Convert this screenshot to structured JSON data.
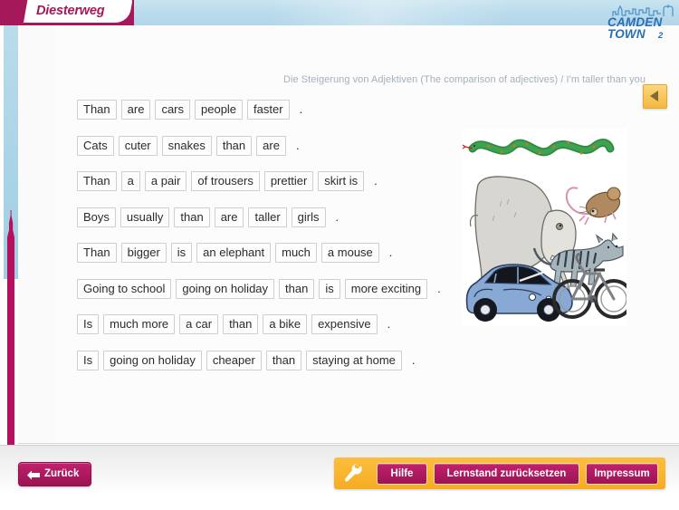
{
  "header": {
    "publisher_logo": "Diesterweg",
    "series_logo_line1": "CAMDEN",
    "series_logo_line2": "TOWN",
    "series_logo_number": "2",
    "skyline_icon": "london-skyline-icon"
  },
  "lesson": {
    "subtitle": "Die Steigerung von Adjektiven (The comparison of adjectives) / I'm taller than you"
  },
  "exercise": {
    "rows": [
      {
        "words": [
          "Than",
          "are",
          "cars",
          "people",
          "faster"
        ],
        "punctuation": "."
      },
      {
        "words": [
          "Cats",
          "cuter",
          "snakes",
          "than",
          "are"
        ],
        "punctuation": "."
      },
      {
        "words": [
          "Than",
          "a",
          "a pair",
          "of trousers",
          "prettier",
          "skirt is"
        ],
        "punctuation": "."
      },
      {
        "words": [
          "Boys",
          "usually",
          "than",
          "are",
          "taller",
          "girls"
        ],
        "punctuation": "."
      },
      {
        "words": [
          "Than",
          "bigger",
          "is",
          "an elephant",
          "much",
          "a mouse"
        ],
        "punctuation": "."
      },
      {
        "words": [
          "Going to school",
          "going on holiday",
          "than",
          "is",
          "more exciting"
        ],
        "punctuation": "."
      },
      {
        "words": [
          "Is",
          "much more",
          "a car",
          "than",
          "a bike",
          "expensive"
        ],
        "punctuation": "."
      },
      {
        "words": [
          "Is",
          "going on holiday",
          "cheaper",
          "than",
          "staying at home"
        ],
        "punctuation": "."
      }
    ]
  },
  "illustration": {
    "name": "animals-and-vehicles-illustration",
    "subjects": [
      "snake",
      "elephant",
      "mouse",
      "cat",
      "car",
      "bicycle"
    ]
  },
  "side_tab": {
    "icon": "triangle-left-icon"
  },
  "footer": {
    "back_label": "Zurück",
    "back_icon": "arrow-left-icon",
    "tools_icon": "wrench-icon",
    "help_label": "Hilfe",
    "reset_label": "Lernstand zurücksetzen",
    "imprint_label": "Impressum"
  },
  "colors": {
    "brand_magenta": "#a5185a",
    "accent_orange": "#f9b52f",
    "header_blue": "#b9dcea",
    "logo_blue": "#2a6fb5"
  }
}
